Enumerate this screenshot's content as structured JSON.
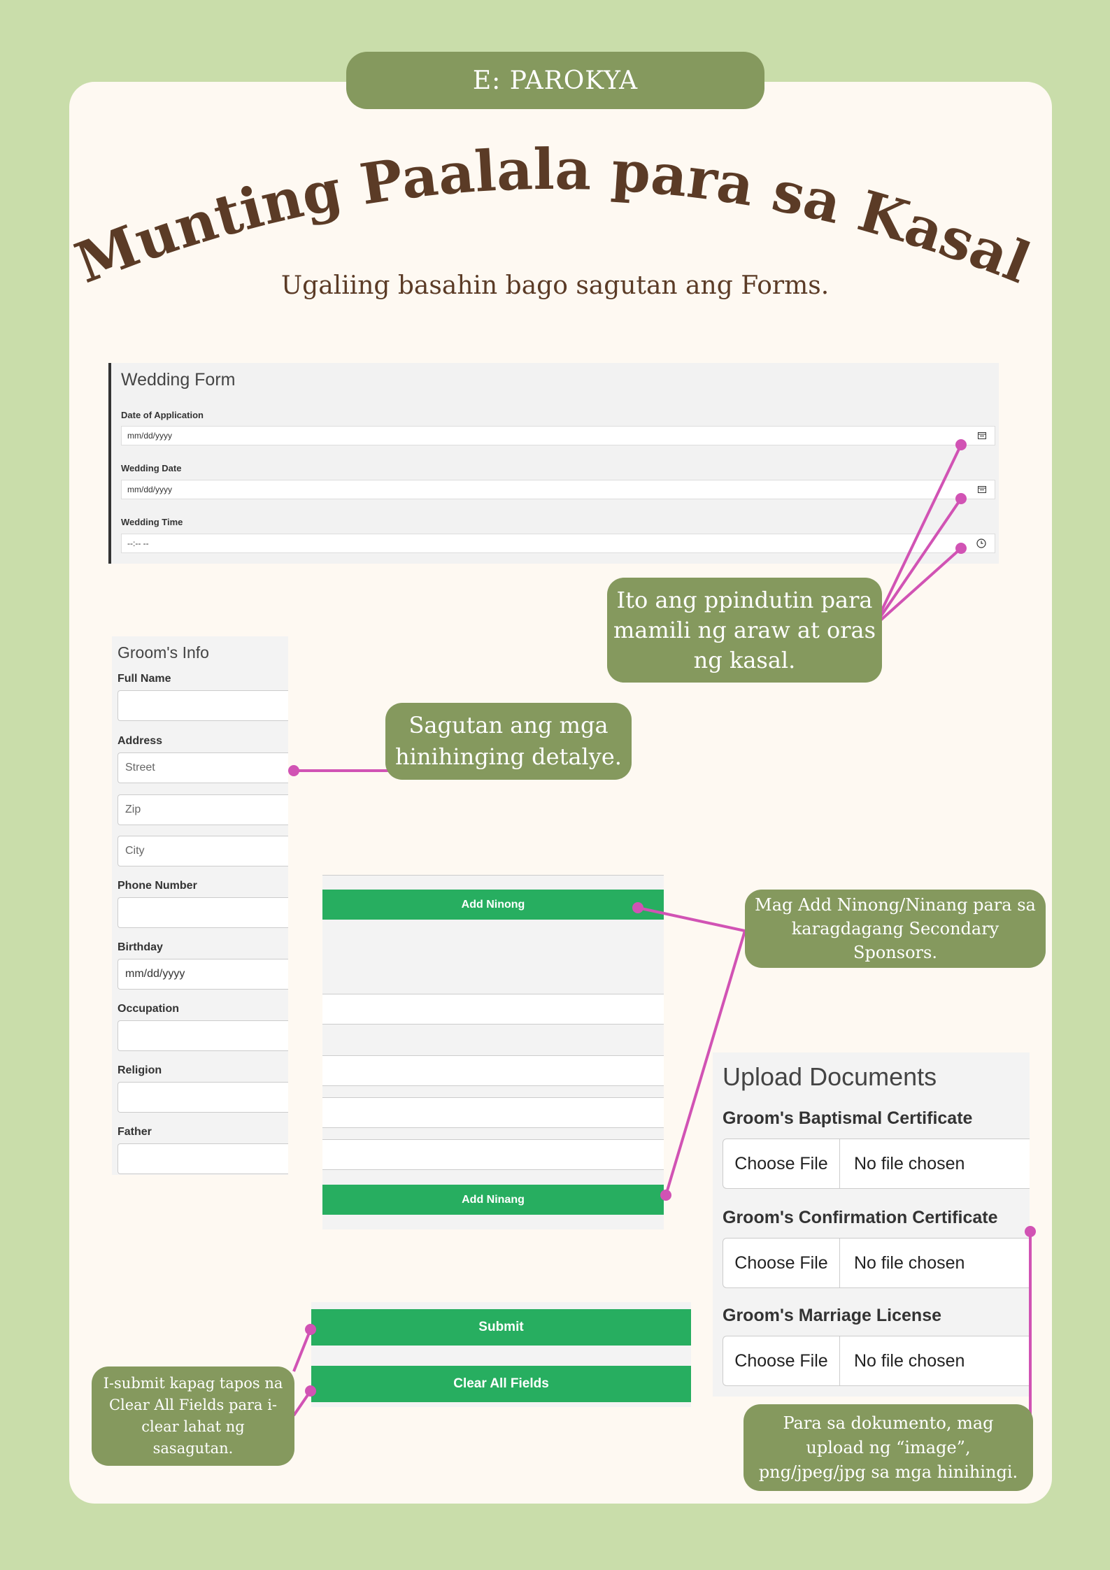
{
  "header": {
    "tab_label": "E: PAROKYA",
    "title": "Munting Paalala para sa Kasal",
    "subtitle": "Ugaliing basahin bago sagutan ang Forms."
  },
  "wedding_form": {
    "title": "Wedding Form",
    "fields": [
      {
        "label": "Date of Application",
        "placeholder": "mm/dd/yyyy",
        "icon": "calendar-icon"
      },
      {
        "label": "Wedding Date",
        "placeholder": "mm/dd/yyyy",
        "icon": "calendar-icon"
      },
      {
        "label": "Wedding Time",
        "placeholder": "--:-- --",
        "icon": "clock-icon"
      }
    ]
  },
  "groom": {
    "title": "Groom's Info",
    "labels": {
      "full_name": "Full Name",
      "address": "Address",
      "phone": "Phone Number",
      "birthday": "Birthday",
      "occupation": "Occupation",
      "religion": "Religion",
      "father": "Father"
    },
    "placeholders": {
      "street": "Street",
      "zip": "Zip",
      "city": "City",
      "birthday": "mm/dd/yyyy"
    }
  },
  "sponsors": {
    "add_ninong": "Add Ninong",
    "add_ninang": "Add Ninang"
  },
  "actions": {
    "submit": "Submit",
    "clear": "Clear All Fields"
  },
  "upload": {
    "title": "Upload Documents",
    "choose_label": "Choose File",
    "no_file": "No file chosen",
    "docs": [
      "Groom's Baptismal Certificate",
      "Groom's Confirmation Certificate",
      "Groom's Marriage License"
    ]
  },
  "callouts": {
    "date_time": [
      "Ito ang ppindutin para",
      "mamili ng araw at oras",
      "ng kasal."
    ],
    "details": [
      "Sagutan ang mga",
      "hinihinging detalye."
    ],
    "sponsors": [
      "Mag Add Ninong/Ninang para sa",
      "karagdagang Secondary",
      "Sponsors."
    ],
    "submit": [
      "I-submit kapag tapos na",
      "Clear All Fields para i-",
      "clear lahat ng",
      "sasagutan."
    ],
    "documents": [
      "Para sa dokumento, mag",
      "upload ng “image”,",
      "png/jpeg/jpg sa mga hinihingi."
    ]
  },
  "colors": {
    "background": "#c9ddaa",
    "card": "#fef9f2",
    "accent": "#85995e",
    "title_brown": "#5b3b26",
    "button_green": "#27ae60",
    "connector": "#d153b4"
  }
}
